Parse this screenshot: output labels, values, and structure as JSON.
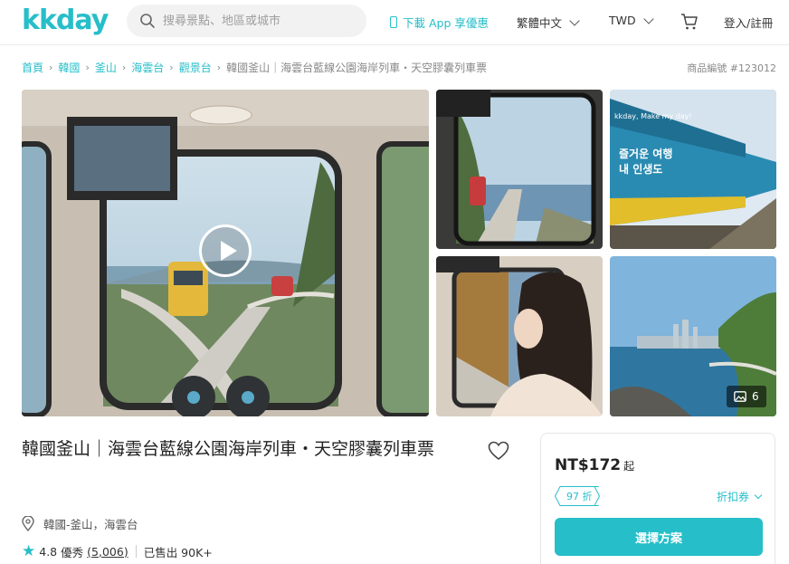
{
  "header": {
    "logo": "kkday",
    "search_placeholder": "搜尋景點、地區或城市",
    "app_link": "下載 App 享優惠",
    "language": "繁體中文",
    "currency": "TWD",
    "login": "登入/註冊"
  },
  "breadcrumb": {
    "items": [
      "首頁",
      "韓國",
      "釜山",
      "海雲台",
      "觀景台"
    ],
    "current": "韓國釜山｜海雲台藍線公園海岸列車・天空膠囊列車票",
    "product_code": "商品編號 #123012"
  },
  "gallery": {
    "photo_count": "6"
  },
  "product": {
    "title": "韓國釜山｜海雲台藍線公園海岸列車・天空膠囊列車票",
    "location": "韓國-釜山，海雲台",
    "rating": "4.8",
    "rating_label": "優秀",
    "review_count": "(5,006)",
    "sold": "已售出 90K+"
  },
  "price_card": {
    "price": "NT$172",
    "price_suffix": "起",
    "discount": "97 折",
    "coupon": "折扣券",
    "choose_button": "選擇方案"
  },
  "colors": {
    "brand": "#26bec9"
  }
}
